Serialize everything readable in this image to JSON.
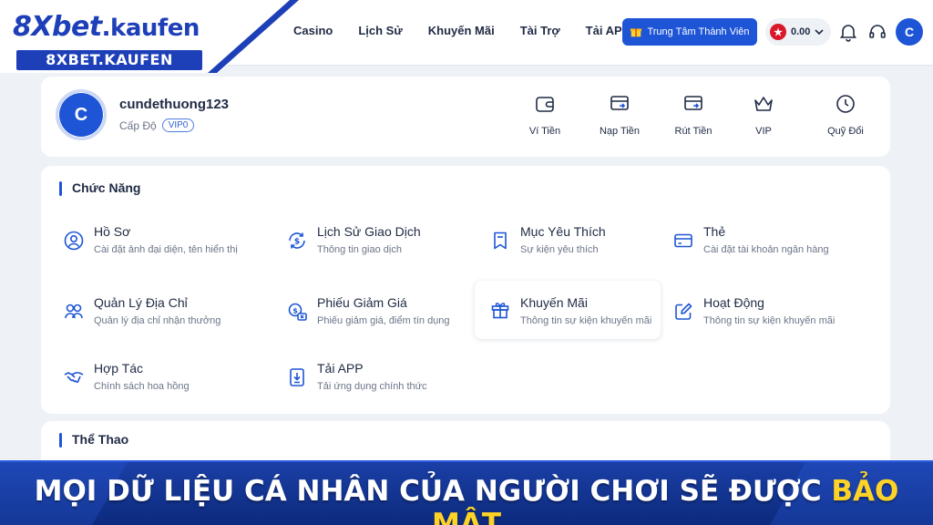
{
  "logo": {
    "brand": "8Xbet",
    "domain": ".kaufen",
    "sub": "8XBET.KAUFEN"
  },
  "nav": [
    {
      "label": "Casino"
    },
    {
      "label": "Lịch Sử"
    },
    {
      "label": "Khuyến Mãi"
    },
    {
      "label": "Tài Trợ"
    },
    {
      "label": "Tải APP"
    }
  ],
  "header": {
    "member_button": "Trung Tâm Thành Viên",
    "balance": "0.00",
    "avatar_letter": "C"
  },
  "profile": {
    "avatar_letter": "C",
    "username": "cundethuong123",
    "level_label": "Cấp Độ",
    "vip_level": "VIP0"
  },
  "quick_actions": [
    {
      "label": "Ví Tiền",
      "icon": "wallet-icon"
    },
    {
      "label": "Nạp Tiền",
      "icon": "deposit-icon"
    },
    {
      "label": "Rút Tiền",
      "icon": "withdraw-icon"
    },
    {
      "label": "VIP",
      "icon": "crown-icon"
    },
    {
      "label": "Quỹ Đổi",
      "icon": "clock-icon"
    }
  ],
  "functions": {
    "title": "Chức Năng",
    "items": [
      {
        "title": "Hồ Sơ",
        "desc": "Cài đặt ảnh đại diện, tên hiển thị",
        "icon": "user-icon"
      },
      {
        "title": "Lịch Sử Giao Dịch",
        "desc": "Thông tin giao dịch",
        "icon": "dollar-cycle-icon"
      },
      {
        "title": "Mục Yêu Thích",
        "desc": "Sự kiện yêu thích",
        "icon": "bookmark-icon"
      },
      {
        "title": "Thẻ",
        "desc": "Cài đặt tài khoản ngân hàng",
        "icon": "card-icon"
      },
      {
        "title": "Quản Lý Địa Chỉ",
        "desc": "Quản lý địa chỉ nhận thưởng",
        "icon": "address-icon"
      },
      {
        "title": "Phiếu Giảm Giá",
        "desc": "Phiếu giảm giá, điểm tín dụng",
        "icon": "coupon-icon"
      },
      {
        "title": "Khuyến Mãi",
        "desc": "Thông tin sự kiện khuyến mãi",
        "icon": "gift-icon"
      },
      {
        "title": "Hoạt Động",
        "desc": "Thông tin sự kiện khuyến mãi",
        "icon": "edit-icon"
      },
      {
        "title": "Hợp Tác",
        "desc": "Chính sách hoa hồng",
        "icon": "handshake-icon"
      },
      {
        "title": "Tải APP",
        "desc": "Tải ứng dụng chính thức",
        "icon": "download-icon"
      }
    ]
  },
  "sports": {
    "title": "Thể Thao"
  },
  "banner": {
    "text_main": "MỌI DỮ LIỆU CÁ NHÂN CỦA NGƯỜI CHƠI SẼ ĐƯỢC ",
    "text_highlight": "BẢO MẬT"
  },
  "colors": {
    "primary": "#1d55d6",
    "brand": "#1d3fb8",
    "banner_highlight": "#ffd326",
    "badge_red": "#d9192a"
  }
}
